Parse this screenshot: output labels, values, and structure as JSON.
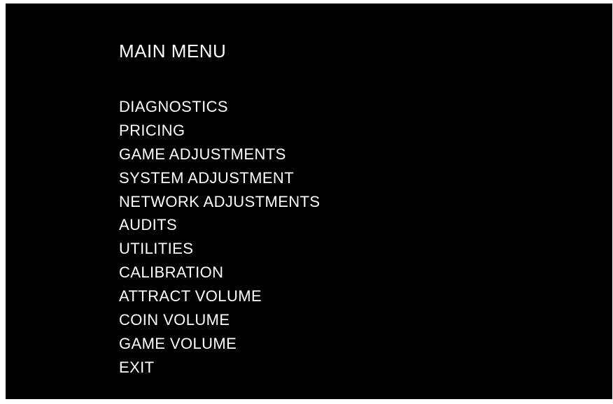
{
  "screen": {
    "title": "MAIN MENU",
    "items": [
      {
        "label": "DIAGNOSTICS"
      },
      {
        "label": "PRICING"
      },
      {
        "label": "GAME ADJUSTMENTS"
      },
      {
        "label": "SYSTEM ADJUSTMENT"
      },
      {
        "label": "NETWORK ADJUSTMENTS"
      },
      {
        "label": "AUDITS"
      },
      {
        "label": "UTILITIES"
      },
      {
        "label": "CALIBRATION"
      },
      {
        "label": "ATTRACT VOLUME"
      },
      {
        "label": "COIN VOLUME"
      },
      {
        "label": "GAME VOLUME"
      },
      {
        "label": "EXIT"
      }
    ]
  },
  "colors": {
    "background": "#000000",
    "text": "#ffffff"
  }
}
